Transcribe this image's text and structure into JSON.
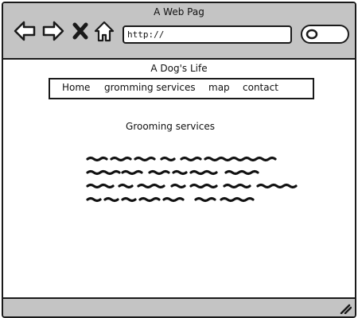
{
  "window": {
    "title": "A Web Pag"
  },
  "toolbar": {
    "back_icon": "back-arrow-icon",
    "forward_icon": "forward-arrow-icon",
    "stop_icon": "close-x-icon",
    "home_icon": "home-icon",
    "url_value": "http://",
    "search_icon": "search-icon"
  },
  "site": {
    "title": "A Dog's Life",
    "nav": [
      {
        "label": "Home"
      },
      {
        "label": "gromming services"
      },
      {
        "label": "map"
      },
      {
        "label": "contact"
      }
    ]
  },
  "content": {
    "heading": "Grooming services",
    "paragraph_placeholder": "scribbled-text-block"
  },
  "statusbar": {
    "grip_icon": "resize-grip-icon"
  },
  "colors": {
    "chrome": "#c4c4c4",
    "stroke": "#1a1a1a",
    "page": "#ffffff"
  }
}
